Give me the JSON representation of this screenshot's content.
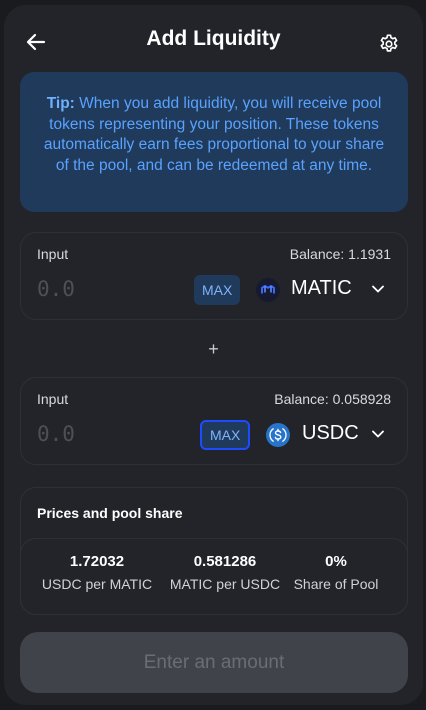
{
  "header": {
    "title": "Add Liquidity"
  },
  "tip": {
    "label": "Tip:",
    "text": "When you add liquidity, you will receive pool tokens representing your position. These tokens automatically earn fees proportional to your share of the pool, and can be redeemed at any time."
  },
  "inputs": [
    {
      "label": "Input",
      "balance": "Balance: 1.1931",
      "placeholder": "0.0",
      "max_label": "MAX",
      "token": "MATIC"
    },
    {
      "label": "Input",
      "balance": "Balance: 0.058928",
      "placeholder": "0.0",
      "max_label": "MAX",
      "token": "USDC"
    }
  ],
  "plus": "+",
  "prices": {
    "title": "Prices and pool share",
    "stats": [
      {
        "value": "1.72032",
        "label": "USDC per MATIC"
      },
      {
        "value": "0.581286",
        "label": "MATIC per USDC"
      },
      {
        "value": "0%",
        "label": "Share of Pool"
      }
    ]
  },
  "cta": {
    "label": "Enter an amount"
  },
  "colors": {
    "accent": "#1f4bff",
    "tip_bg": "#1f3a5a",
    "tip_text": "#5aa2ff",
    "usdc": "#2775ca",
    "matic_bg": "#171a2e"
  },
  "icons": {
    "back": "arrow-left-icon",
    "settings": "gear-icon",
    "chevron": "chevron-down-icon"
  }
}
